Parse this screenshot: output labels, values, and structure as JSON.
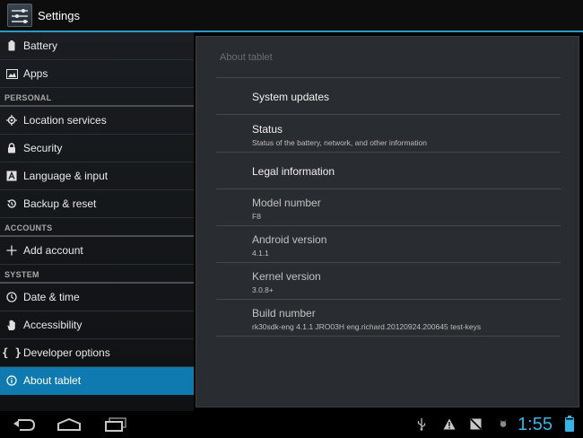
{
  "app": {
    "title": "Settings"
  },
  "sidebar": {
    "top_items": [
      {
        "label": "Battery",
        "icon": "battery-icon"
      },
      {
        "label": "Apps",
        "icon": "apps-icon"
      }
    ],
    "personal": {
      "header": "PERSONAL",
      "items": [
        {
          "label": "Location services",
          "icon": "location-icon"
        },
        {
          "label": "Security",
          "icon": "lock-icon"
        },
        {
          "label": "Language & input",
          "icon": "language-icon"
        },
        {
          "label": "Backup & reset",
          "icon": "backup-icon"
        }
      ]
    },
    "accounts": {
      "header": "ACCOUNTS",
      "items": [
        {
          "label": "Add account",
          "icon": "plus-icon"
        }
      ]
    },
    "system": {
      "header": "SYSTEM",
      "items": [
        {
          "label": "Date & time",
          "icon": "clock-icon"
        },
        {
          "label": "Accessibility",
          "icon": "hand-icon"
        },
        {
          "label": "Developer options",
          "icon": "braces-icon"
        },
        {
          "label": "About tablet",
          "icon": "info-icon",
          "selected": true
        }
      ]
    }
  },
  "content": {
    "section_label": "About tablet",
    "items": [
      {
        "title": "System updates",
        "summary": ""
      },
      {
        "title": "Status",
        "summary": "Status of the battery, network, and other information"
      },
      {
        "title": "Legal information",
        "summary": ""
      },
      {
        "title": "Model number",
        "summary": "F8"
      },
      {
        "title": "Android version",
        "summary": "4.1.1"
      },
      {
        "title": "Kernel version",
        "summary": "3.0.8+"
      },
      {
        "title": "Build number",
        "summary": "rk30sdk-eng 4.1.1 JRO03H eng.richard.20120924.200645 test-keys"
      }
    ]
  },
  "navbar": {
    "buttons": [
      "back-icon",
      "home-icon",
      "recent-apps-icon"
    ],
    "status_icons": [
      "usb-icon",
      "warning-icon",
      "no-sim-icon",
      "debug-icon"
    ],
    "clock": "1:55",
    "accent": "#33b5e5"
  }
}
